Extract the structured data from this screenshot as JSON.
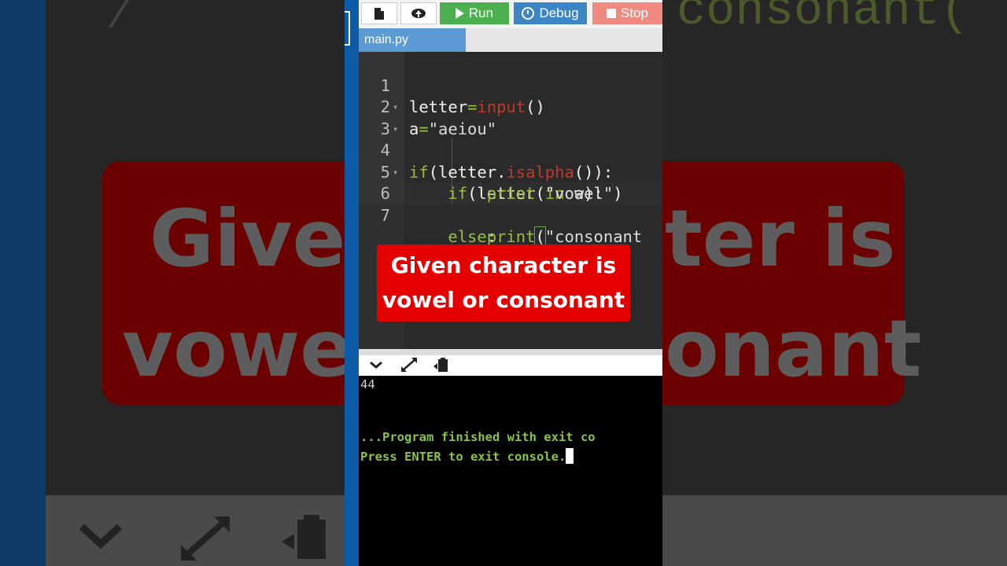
{
  "background": {
    "top_text": "consonant(",
    "banner_line1_left": "Giver",
    "banner_line1_right": "ter is",
    "banner_line2_left": "vowel",
    "banner_line2_right": "onant"
  },
  "toolbar": {
    "run_label": "Run",
    "debug_label": "Debug",
    "stop_label": "Stop"
  },
  "tabs": [
    {
      "label": "main.py",
      "active": true
    }
  ],
  "editor": {
    "line_numbers": [
      "1",
      "2",
      "3",
      "4",
      "5",
      "6",
      "7"
    ]
  },
  "caption": {
    "line1": "Given character is",
    "line2": "vowel or consonant"
  },
  "console": {
    "output_line": "44",
    "finished_line": "...Program finished with exit co",
    "exit_line": "Press ENTER to exit console."
  },
  "colors": {
    "run": "#4caf50",
    "debug": "#3d86c6",
    "stop": "#f08a80",
    "tab_active": "#5b9ad3",
    "caption_bg": "#e50000",
    "keyword": "#97bf3b",
    "builtin": "#c0392b",
    "console_status": "#8bc34a"
  }
}
